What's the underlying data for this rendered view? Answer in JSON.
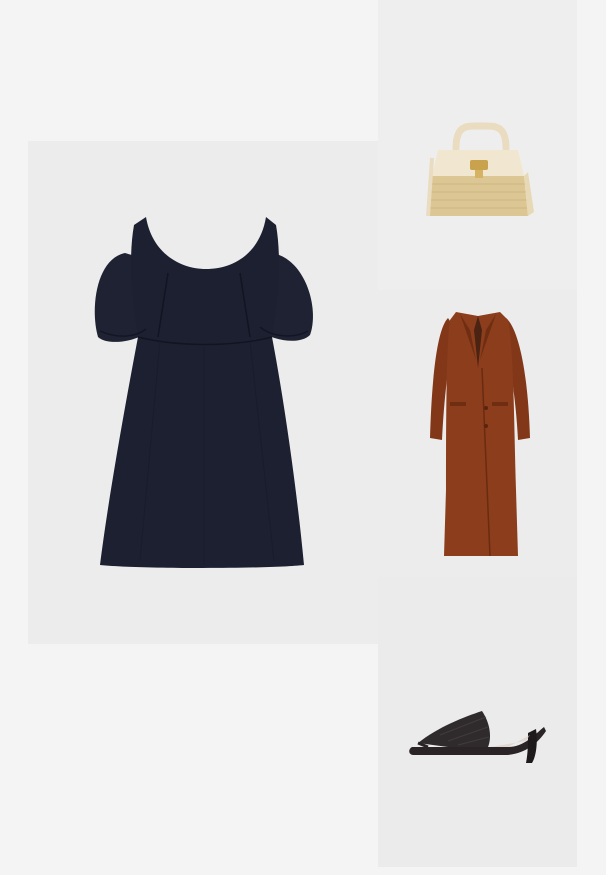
{
  "board": {
    "background": "#f4f4f4",
    "tile_background": "#ececec"
  },
  "items": [
    {
      "id": "dress",
      "icon": "black-puff-sleeve-dress-image",
      "color": "#1c2030"
    },
    {
      "id": "bag",
      "icon": "cream-raffia-top-handle-bag-image",
      "color": "#efe2c6"
    },
    {
      "id": "coat",
      "icon": "rust-long-wool-coat-image",
      "color": "#8a3c1c"
    },
    {
      "id": "sandal",
      "icon": "black-woven-thong-mule-image",
      "color": "#222022"
    }
  ]
}
